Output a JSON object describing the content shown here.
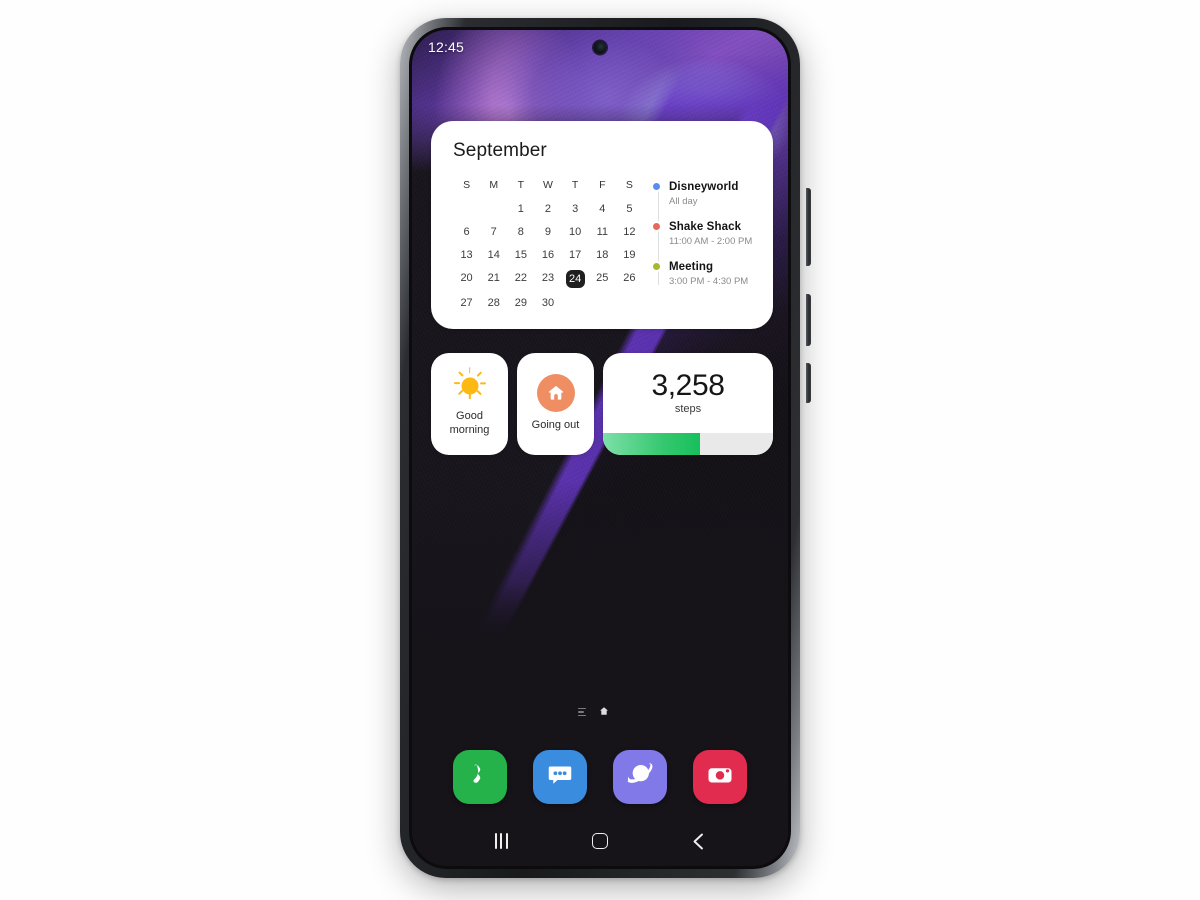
{
  "device": {
    "name": "samsung-galaxy-s21-phone",
    "frame_color": "#232427",
    "screen_bg": "#161319"
  },
  "status_bar": {
    "clock": "12:45",
    "camera": "punch-hole-camera"
  },
  "calendar_widget": {
    "month": "September",
    "day_headers": [
      "S",
      "M",
      "T",
      "W",
      "T",
      "F",
      "S"
    ],
    "leading_blanks": 2,
    "days": [
      1,
      2,
      3,
      4,
      5,
      6,
      7,
      8,
      9,
      10,
      11,
      12,
      13,
      14,
      15,
      16,
      17,
      18,
      19,
      20,
      21,
      22,
      23,
      24,
      25,
      26,
      27,
      28,
      29,
      30
    ],
    "today": 24,
    "events": [
      {
        "title": "Disneyworld",
        "time": "All day",
        "color": "#5B8DEF"
      },
      {
        "title": "Shake Shack",
        "time": "11:00 AM - 2:00 PM",
        "color": "#E5695F"
      },
      {
        "title": "Meeting",
        "time": "3:00 PM - 4:30 PM",
        "color": "#A8B832"
      }
    ]
  },
  "widgets": {
    "good_morning": {
      "icon": "sun-icon",
      "icon_color": "#FDB913",
      "label_line1": "Good",
      "label_line2": "morning"
    },
    "going_out": {
      "icon": "home-icon",
      "icon_bg": "#EE8E62",
      "label": "Going out"
    },
    "steps": {
      "count": "3,258",
      "unit": "steps",
      "progress_percent": 57,
      "fill_color": "#2ec566",
      "track_color": "#e9e9e9"
    }
  },
  "page_indicator": {
    "items": [
      {
        "name": "samsung-free-page",
        "type": "lines",
        "active": false
      },
      {
        "name": "home-page",
        "type": "home",
        "active": true
      },
      {
        "name": "second-page",
        "type": "dot",
        "active": false
      }
    ]
  },
  "dock": {
    "apps": [
      {
        "name": "phone-app-icon",
        "label": "Phone",
        "color": "#26B24B",
        "glyph": "phone-icon"
      },
      {
        "name": "messages-app-icon",
        "label": "Messages",
        "color": "#3A8DDE",
        "glyph": "message-bubble-icon"
      },
      {
        "name": "internet-app-icon",
        "label": "Internet",
        "color": "#8279E8",
        "glyph": "planet-icon"
      },
      {
        "name": "camera-app-icon",
        "label": "Camera",
        "color": "#E12B4F",
        "glyph": "camera-icon"
      }
    ]
  },
  "nav_bar": {
    "recents_label": "Recents",
    "home_label": "Home",
    "back_label": "Back"
  }
}
